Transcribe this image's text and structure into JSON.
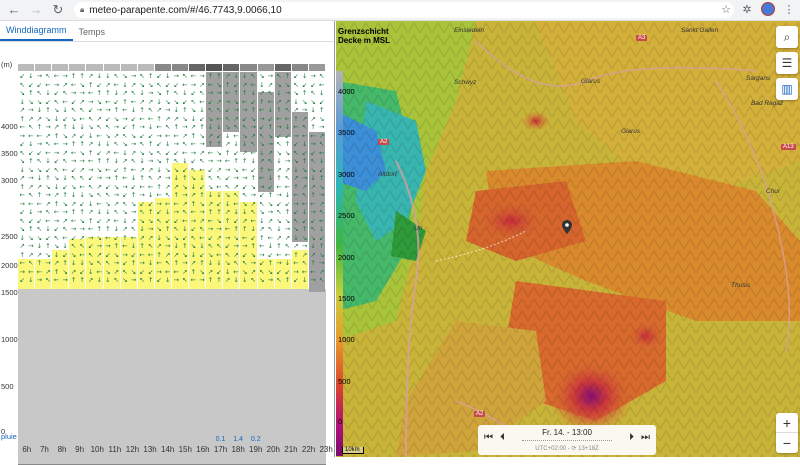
{
  "browser": {
    "url": "meteo-parapente.com/#/46.7743,9.0066,10"
  },
  "tabs": [
    {
      "label": "Winddiagramm",
      "active": true
    },
    {
      "label": "Temps",
      "active": false
    }
  ],
  "diagram": {
    "y_unit": "(m)",
    "y_labels": [
      "4000",
      "3500",
      "3000",
      "2500",
      "2000",
      "1500",
      "1000",
      "500",
      "0"
    ],
    "hours": [
      "6h",
      "7h",
      "8h",
      "9h",
      "10h",
      "11h",
      "12h",
      "13h",
      "14h",
      "15h",
      "16h",
      "17h",
      "18h",
      "19h",
      "20h",
      "21h",
      "22h",
      "23h"
    ],
    "rain_label": "pluie",
    "rain_values": [
      "",
      "",
      "",
      "",
      "",
      "",
      "",
      "",
      "",
      "",
      "",
      "0.1",
      "1.4",
      "0.2",
      "",
      "",
      "",
      ""
    ]
  },
  "map": {
    "legend_title": "Grenzschicht Decke m MSL",
    "legend_ticks": [
      "4000",
      "3500",
      "3000",
      "2500",
      "2000",
      "1500",
      "1000",
      "500",
      "0"
    ],
    "scale_label": "10km",
    "places": [
      "Schwyz",
      "Glarus",
      "Glarus",
      "Altdorf",
      "Uri",
      "Sargans",
      "Bad Ragaz",
      "Chur",
      "Thusis",
      "Einsiedeln",
      "Sankt Gallen"
    ],
    "roads": [
      "A3",
      "A2",
      "A13",
      "A2"
    ],
    "time": {
      "date": "Fr. 14. - 13:00",
      "sub": "UTC+02:00 - ⟳ 13+18Z"
    },
    "colors": {
      "high": "#7a0b6e",
      "mid": "#e89a2c",
      "low": "#3fb53f"
    }
  }
}
